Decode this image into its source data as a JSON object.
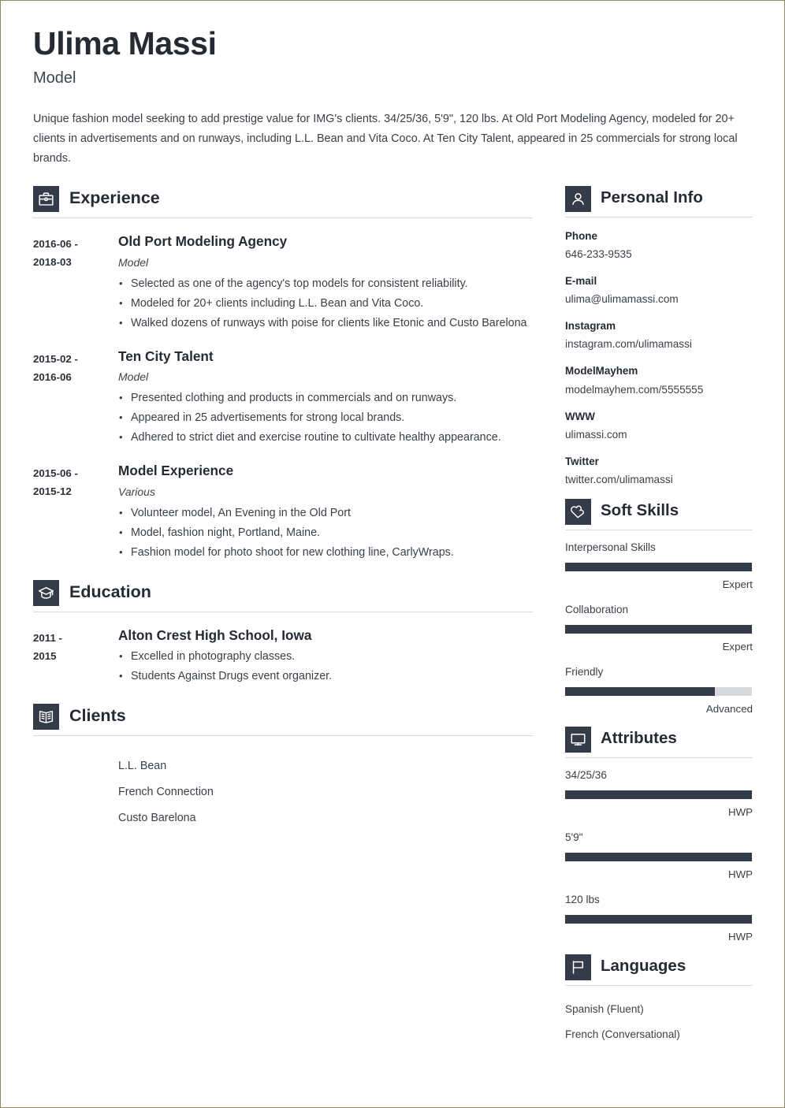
{
  "header": {
    "name": "Ulima Massi",
    "job_title": "Model",
    "summary": "Unique fashion model seeking to add prestige value for IMG's clients. 34/25/36, 5'9\", 120 lbs. At Old Port Modeling Agency, modeled for 20+ clients in advertisements and on runways, including L.L. Bean and Vita Coco. At Ten City Talent, appeared in 25 commercials for strong local brands."
  },
  "colors": {
    "accent_dark": "#343b49",
    "text_dark": "#262b33",
    "text_body": "#3a3f47",
    "rule": "#d9dadd",
    "track": "#d7d8d9",
    "page_border": "#8a8a5c"
  },
  "experience": {
    "title": "Experience",
    "icon": "briefcase-icon",
    "entries": [
      {
        "dates": "2016-06 - 2018-03",
        "date_start": "2016-06 -",
        "date_end": "2018-03",
        "org": "Old Port Modeling Agency",
        "role": "Model",
        "bullets": [
          "Selected as one of the agency's top models for consistent reliability.",
          "Modeled for 20+ clients including L.L. Bean and Vita Coco.",
          "Walked dozens of runways with poise for clients like Etonic and Custo Barelona"
        ]
      },
      {
        "dates": "2015-02 - 2016-06",
        "date_start": "2015-02 -",
        "date_end": "2016-06",
        "org": "Ten City Talent",
        "role": "Model",
        "bullets": [
          "Presented clothing and products in commercials and on runways.",
          "Appeared in 25 advertisements for strong local brands.",
          "Adhered to strict diet and exercise routine to cultivate healthy appearance."
        ]
      },
      {
        "dates": "2015-06 - 2015-12",
        "date_start": "2015-06 -",
        "date_end": "2015-12",
        "org": "Model Experience",
        "role": "Various",
        "bullets": [
          "Volunteer model, An Evening in the Old Port",
          "Model, fashion night, Portland, Maine.",
          "Fashion model for photo shoot for new clothing line, CarlyWraps."
        ]
      }
    ]
  },
  "education": {
    "title": "Education",
    "icon": "graduation-cap-icon",
    "entries": [
      {
        "date_start": "2011 -",
        "date_end": "2015",
        "org": "Alton Crest High School, Iowa",
        "role": "",
        "bullets": [
          "Excelled in photography classes.",
          "Students Against Drugs event organizer."
        ]
      }
    ]
  },
  "clients": {
    "title": "Clients",
    "icon": "open-book-icon",
    "items": [
      "L.L. Bean",
      "French Connection",
      "Custo Barelona"
    ]
  },
  "personal_info": {
    "title": "Personal Info",
    "icon": "person-icon",
    "items": [
      {
        "label": "Phone",
        "value": "646-233-9535"
      },
      {
        "label": "E-mail",
        "value": "ulima@ulimamassi.com"
      },
      {
        "label": "Instagram",
        "value": "instagram.com/ulimamassi"
      },
      {
        "label": "ModelMayhem",
        "value": "modelmayhem.com/5555555"
      },
      {
        "label": "WWW",
        "value": "ulimassi.com"
      },
      {
        "label": "Twitter",
        "value": "twitter.com/ulimamassi"
      }
    ]
  },
  "soft_skills": {
    "title": "Soft Skills",
    "icon": "heart-puzzle-icon",
    "items": [
      {
        "name": "Interpersonal Skills",
        "level": "Expert",
        "percent": 100
      },
      {
        "name": "Collaboration",
        "level": "Expert",
        "percent": 100
      },
      {
        "name": "Friendly",
        "level": "Advanced",
        "percent": 80
      }
    ]
  },
  "attributes": {
    "title": "Attributes",
    "icon": "monitor-icon",
    "items": [
      {
        "name": "34/25/36",
        "level": "HWP",
        "percent": 100
      },
      {
        "name": "5'9\"",
        "level": "HWP",
        "percent": 100
      },
      {
        "name": "120 lbs",
        "level": "HWP",
        "percent": 100
      }
    ]
  },
  "languages": {
    "title": "Languages",
    "icon": "flag-icon",
    "items": [
      "Spanish (Fluent)",
      "French (Conversational)"
    ]
  }
}
